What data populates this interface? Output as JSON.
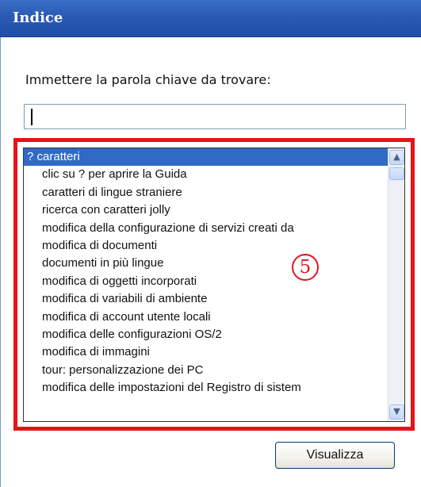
{
  "header": {
    "title": "Indice"
  },
  "prompt": "Immettere la parola chiave da trovare:",
  "search": {
    "value": ""
  },
  "list": {
    "items": [
      {
        "label": "? caratteri",
        "selected": true
      },
      {
        "label": "clic su ? per aprire la Guida",
        "selected": false
      },
      {
        "label": "caratteri di lingue straniere",
        "selected": false
      },
      {
        "label": "ricerca con caratteri jolly",
        "selected": false
      },
      {
        "label": "modifica della configurazione di servizi creati da",
        "selected": false
      },
      {
        "label": "modifica di documenti",
        "selected": false
      },
      {
        "label": "documenti in più lingue",
        "selected": false
      },
      {
        "label": "modifica di oggetti incorporati",
        "selected": false
      },
      {
        "label": "modifica di variabili di ambiente",
        "selected": false
      },
      {
        "label": "modifica di account utente locali",
        "selected": false
      },
      {
        "label": "modifica delle configurazioni OS/2",
        "selected": false
      },
      {
        "label": "modifica di immagini",
        "selected": false
      },
      {
        "label": "tour: personalizzazione dei PC",
        "selected": false
      },
      {
        "label": "modifica delle impostazioni del Registro di sistem",
        "selected": false
      }
    ]
  },
  "annotation": {
    "label": "5",
    "color": "#e8121a"
  },
  "button": {
    "label": "Visualizza"
  },
  "colors": {
    "header": "#2a5ab4",
    "selection": "#316ac5",
    "highlight": "#e8121a"
  }
}
